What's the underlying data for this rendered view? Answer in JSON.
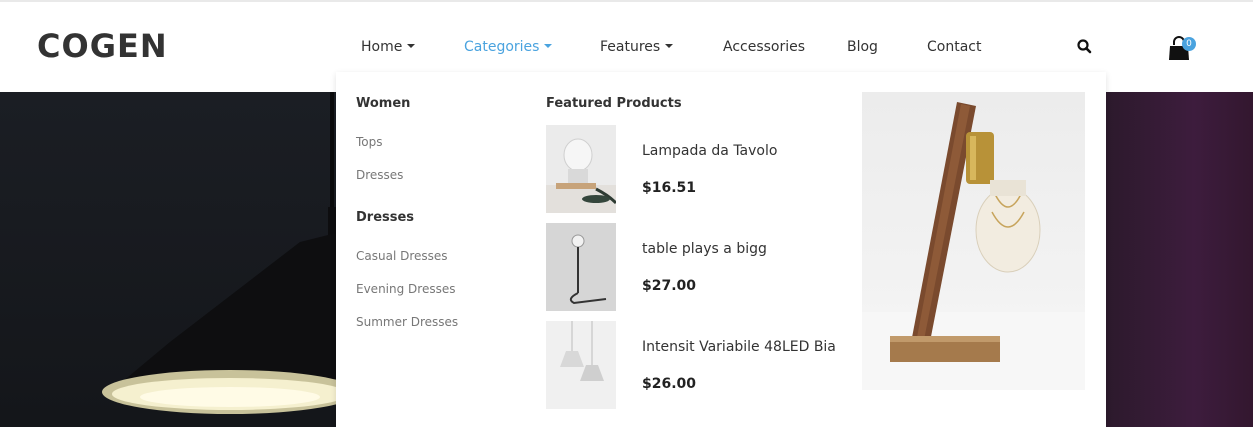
{
  "brand": {
    "logo_text": "COGEN"
  },
  "nav": {
    "items": [
      {
        "label": "Home",
        "has_dropdown": true,
        "active": false
      },
      {
        "label": "Categories",
        "has_dropdown": true,
        "active": true
      },
      {
        "label": "Features",
        "has_dropdown": true,
        "active": false
      },
      {
        "label": "Accessories",
        "has_dropdown": false,
        "active": false
      },
      {
        "label": "Blog",
        "has_dropdown": false,
        "active": false
      },
      {
        "label": "Contact",
        "has_dropdown": false,
        "active": false
      }
    ],
    "search_icon": "search-icon",
    "cart_icon": "shopping-bag-icon",
    "cart_count": "0",
    "accent_color": "#4aa3df"
  },
  "mega_menu": {
    "women": {
      "title": "Women",
      "links": [
        "Tops",
        "Dresses"
      ]
    },
    "dresses": {
      "title": "Dresses",
      "links": [
        "Casual Dresses",
        "Evening Dresses",
        "Summer Dresses"
      ]
    },
    "featured": {
      "title": "Featured Products",
      "products": [
        {
          "name": "Lampada da Tavolo",
          "price": "$16.51"
        },
        {
          "name": "table plays a bigg",
          "price": "$27.00"
        },
        {
          "name": "Intensit Variabile 48LED Bia",
          "price": "$26.00"
        }
      ]
    }
  }
}
